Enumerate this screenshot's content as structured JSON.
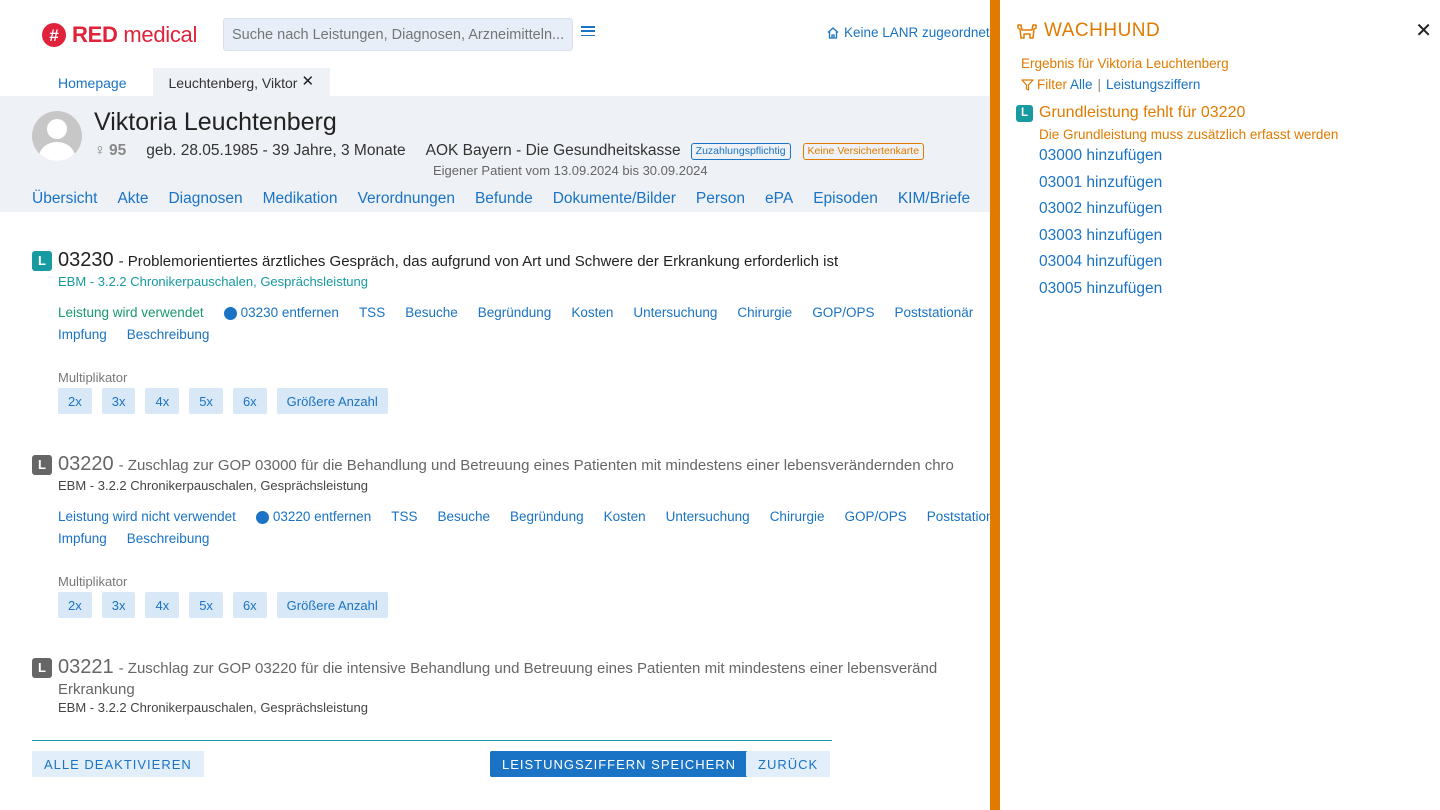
{
  "header": {
    "logo": {
      "mark": "#",
      "brand_bold": "RED",
      "brand_rest": " medical"
    },
    "search": {
      "placeholder": "Suche nach Leistungen, Diagnosen, Arzneimitteln..."
    },
    "lanr": "Keine LANR zugeordnet"
  },
  "tabs": [
    {
      "label": "Homepage"
    },
    {
      "label": "Leuchtenberg, Viktor",
      "close": "✕"
    }
  ],
  "patient": {
    "name": "Viktoria Leuchtenberg",
    "gender_symbol": "♀",
    "age_number": "95",
    "birth": "geb. 28.05.1985 - 39 Jahre, 3 Monate",
    "insurance": "AOK Bayern - Die Gesundheitskasse",
    "badges": [
      "Zuzahlungspflichtig",
      "Keine Versichertenkarte"
    ],
    "eigener": "Eigener Patient vom 13.09.2024 bis 30.09.2024",
    "nav": [
      "Übersicht",
      "Akte",
      "Diagnosen",
      "Medikation",
      "Verordnungen",
      "Befunde",
      "Dokumente/Bilder",
      "Person",
      "ePA",
      "Episoden",
      "KIM/Briefe"
    ]
  },
  "services": [
    {
      "badge": "L",
      "code": "03230",
      "description": "- Problemorientiertes ärztliches Gespräch, das aufgrund von Art und Schwere der Erkrankung erforderlich ist",
      "category": "EBM - 3.2.2 Chronikerpauschalen, Gesprächsleistung",
      "state_prefix": "Leistung wird ",
      "state_word": "verwendet",
      "remove": "03230 entfernen",
      "links": [
        "TSS",
        "Besuche",
        "Begründung",
        "Kosten",
        "Untersuchung",
        "Chirurgie",
        "GOP/OPS",
        "Poststationär",
        "Impfung",
        "Beschreibung"
      ],
      "multiplier_label": "Multiplikator",
      "multipliers": [
        "2x",
        "3x",
        "4x",
        "5x",
        "6x",
        "Größere Anzahl"
      ]
    },
    {
      "badge": "L",
      "code": "03220",
      "description": "- Zuschlag zur GOP 03000 für die Behandlung und Betreuung eines Patienten mit mindestens einer lebensverändernden chro",
      "category": "EBM - 3.2.2 Chronikerpauschalen, Gesprächsleistung",
      "state_prefix": "Leistung wird ",
      "state_word": "nicht verwendet",
      "remove": "03220 entfernen",
      "links": [
        "TSS",
        "Besuche",
        "Begründung",
        "Kosten",
        "Untersuchung",
        "Chirurgie",
        "GOP/OPS",
        "Poststation",
        "Impfung",
        "Beschreibung"
      ],
      "multiplier_label": "Multiplikator",
      "multipliers": [
        "2x",
        "3x",
        "4x",
        "5x",
        "6x",
        "Größere Anzahl"
      ]
    },
    {
      "badge": "L",
      "code": "03221",
      "description": "- Zuschlag zur GOP 03220 für die intensive Behandlung und Betreuung eines Patienten mit mindestens einer lebensveränd",
      "description_line2": "Erkrankung",
      "category": "EBM - 3.2.2 Chronikerpauschalen, Gesprächsleistung"
    }
  ],
  "footer": {
    "deactivate": "ALLE DEAKTIVIEREN",
    "save": "LEISTUNGSZIFFERN SPEICHERN",
    "back": "ZURÜCK"
  },
  "watchdog": {
    "title": "WACHHUND",
    "close": "✕",
    "result": "Ergebnis für Viktoria Leuchtenberg",
    "filter_label": "Filter",
    "filter_all": "Alle",
    "filter_sep": "|",
    "filter_codes": "Leistungsziffern",
    "item_badge": "L",
    "item_title": "Grundleistung fehlt für 03220",
    "item_sub": "Die Grundleistung muss zusätzlich erfasst werden",
    "links": [
      "03000 hinzufügen",
      "03001 hinzufügen",
      "03002 hinzufügen",
      "03003 hinzufügen",
      "03004 hinzufügen",
      "03005 hinzufügen"
    ]
  },
  "colors": {
    "brand_red": "#e0223b",
    "link_blue": "#1a73c4",
    "teal": "#179aa0",
    "watchdog_orange": "#e07b00",
    "not_used_red": "#d3164b"
  }
}
